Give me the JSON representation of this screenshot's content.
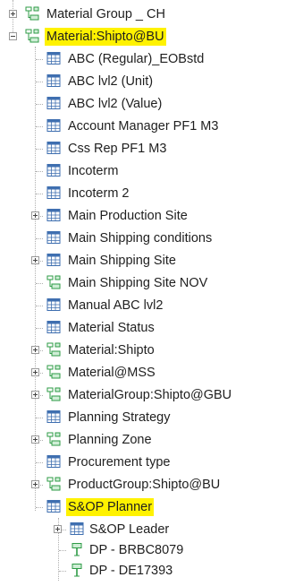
{
  "tree": {
    "group": "Material Group _ CH",
    "parent": "Material:Shipto@BU",
    "children": [
      "ABC (Regular)_EOBstd",
      "ABC lvl2 (Unit)",
      "ABC lvl2 (Value)",
      "Account Manager PF1 M3",
      "Css Rep PF1 M3",
      "Incoterm",
      "Incoterm 2",
      "Main Production Site",
      "Main Shipping conditions",
      "Main Shipping Site",
      "Main Shipping Site NOV",
      "Manual ABC lvl2",
      "Material Status",
      "Material:Shipto",
      "Material@MSS",
      "MaterialGroup:Shipto@GBU",
      "Planning Strategy",
      "Planning Zone",
      "Procurement type",
      "ProductGroup:Shipto@BU",
      "S&OP Planner"
    ],
    "planner_children": [
      "S&OP Leader",
      "DP - BRBC8079",
      "DP - DE17393"
    ]
  },
  "icons": {
    "hierarchy": "hierarchy-icon",
    "attribute": "attribute-table-icon",
    "member": "member-icon"
  },
  "colors": {
    "highlight": "#fff200",
    "table_blue": "#3f6fb0",
    "hierarchy_green": "#2e9b46"
  }
}
